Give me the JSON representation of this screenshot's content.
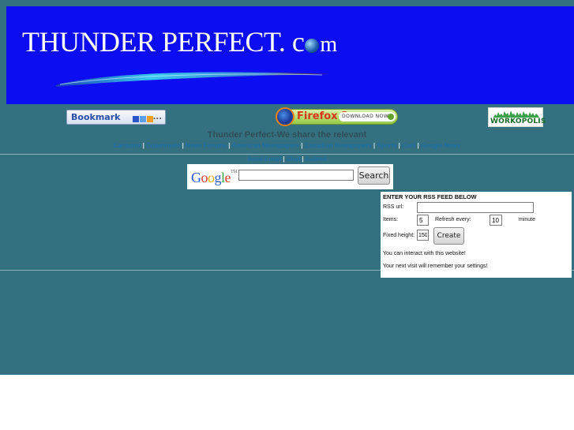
{
  "banner": {
    "title_main": "THUNDER PERFECT. c",
    "title_end": "m",
    "bg_color": "#0d0df2"
  },
  "toolbar": {
    "bookmark_label": "Bookmark",
    "bookmark_more": "...",
    "firefox_label": "Firefox 3",
    "firefox_download": "DOWNLOAD NOW",
    "workopolis_label": "WORKOPOLIS"
  },
  "tagline": "Thunder Perfect-We share the relevant",
  "nav": {
    "row1": [
      "Cartoons",
      "Columnists",
      "News Forums",
      "American Newspapers",
      "Canadian Newspapers",
      "Sports",
      "Cool",
      "Google News"
    ],
    "row2": [
      "Send Email",
      "Chat",
      "Submit"
    ]
  },
  "search": {
    "logo": "Google",
    "tm": "TM",
    "input_value": "",
    "button_label": "Search"
  },
  "rss": {
    "heading": "ENTER YOUR RSS FEED BELOW",
    "url_label": "RSS url:",
    "url_value": "",
    "items_label": "Items:",
    "items_value": "5",
    "refresh_label": "Refresh every:",
    "refresh_value": "10",
    "minute_label": "minute",
    "height_label": "Fixed height:",
    "height_value": "150",
    "create_label": "Create",
    "note1": "You can interact with this website!",
    "note2": "Your next visit will remember your settings!"
  },
  "colors": {
    "page_bg": "#357080",
    "link": "#1d6fa5",
    "separator": "#d8e4e8"
  }
}
